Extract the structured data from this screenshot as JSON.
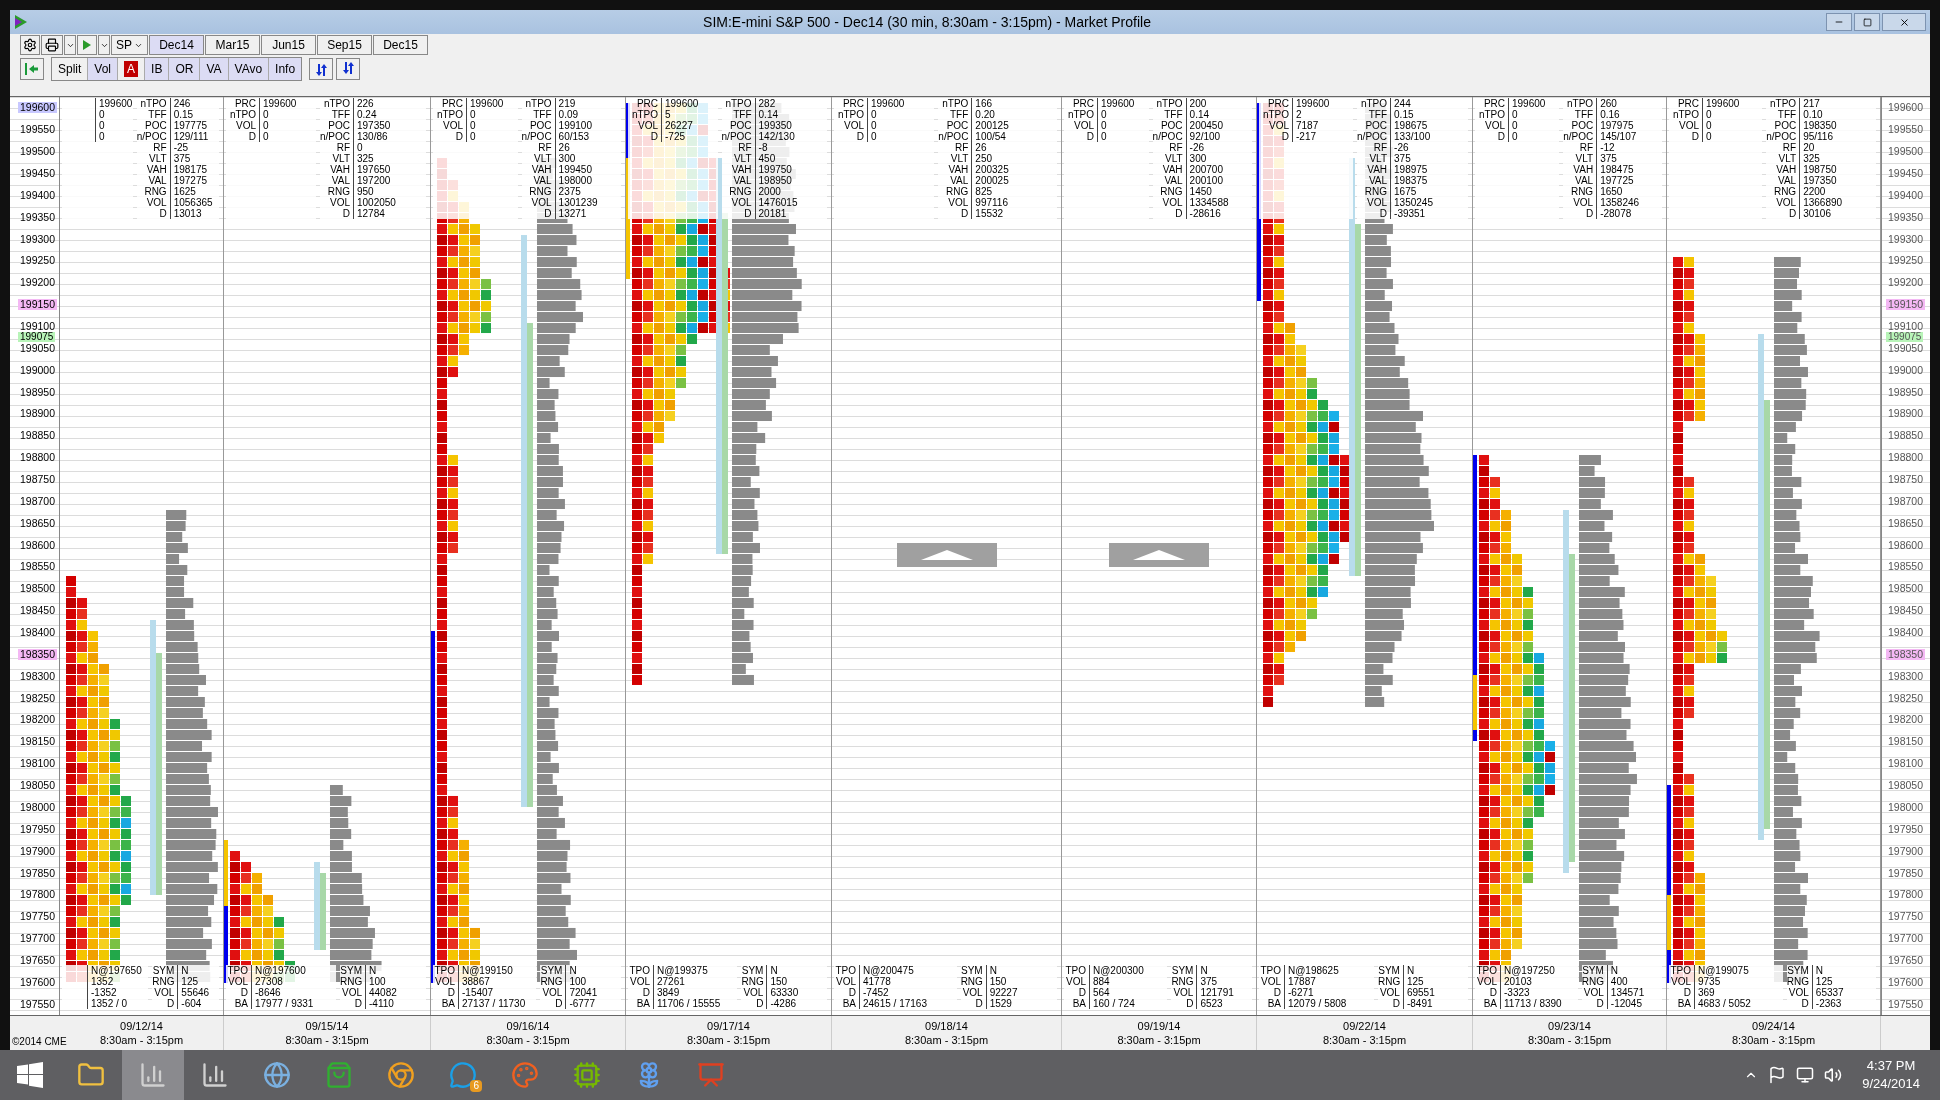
{
  "window": {
    "title": "SIM:E-mini S&P 500 - Dec14 (30 min, 8:30am - 3:15pm) - Market Profile"
  },
  "toolbar": {
    "symbol": "SP",
    "contracts": [
      {
        "label": "Dec14",
        "selected": true
      },
      {
        "label": "Mar15",
        "selected": false
      },
      {
        "label": "Jun15",
        "selected": false
      },
      {
        "label": "Sep15",
        "selected": false
      },
      {
        "label": "Dec15",
        "selected": false
      }
    ],
    "toggles": [
      {
        "label": "Split",
        "on": false,
        "kind": "text"
      },
      {
        "label": "Vol",
        "on": true,
        "kind": "text"
      },
      {
        "label": "A",
        "on": true,
        "kind": "letter"
      },
      {
        "label": "IB",
        "on": true,
        "kind": "text"
      },
      {
        "label": "OR",
        "on": true,
        "kind": "text"
      },
      {
        "label": "VA",
        "on": true,
        "kind": "text"
      },
      {
        "label": "VAvo",
        "on": true,
        "kind": "text"
      },
      {
        "label": "Info",
        "on": true,
        "kind": "text"
      }
    ]
  },
  "left_axis": [
    {
      "label": "199600",
      "color": "#c8c8ff"
    },
    {
      "label": "199550"
    },
    {
      "label": "199500"
    },
    {
      "label": "199450"
    },
    {
      "label": "199400"
    },
    {
      "label": "199350"
    },
    {
      "label": "199300"
    },
    {
      "label": "199250"
    },
    {
      "label": "199200"
    },
    {
      "label": "199150",
      "color": "#f4b8f4"
    },
    {
      "label": "199100"
    },
    {
      "label": "199075",
      "color": "#b8f4b8",
      "kind": "marker"
    },
    {
      "label": "199050"
    },
    {
      "label": "199000"
    },
    {
      "label": "198950"
    },
    {
      "label": "198900"
    },
    {
      "label": "198850"
    },
    {
      "label": "198800"
    },
    {
      "label": "198750"
    },
    {
      "label": "198700"
    },
    {
      "label": "198650"
    },
    {
      "label": "198600"
    },
    {
      "label": "198550"
    },
    {
      "label": "198500"
    },
    {
      "label": "198450"
    },
    {
      "label": "198400"
    },
    {
      "label": "198350",
      "color": "#f4b8f4"
    },
    {
      "label": "198300"
    },
    {
      "label": "198250"
    },
    {
      "label": "198200"
    },
    {
      "label": "198150"
    },
    {
      "label": "198100"
    },
    {
      "label": "198050"
    },
    {
      "label": "198000"
    },
    {
      "label": "197950"
    },
    {
      "label": "197900"
    },
    {
      "label": "197850"
    },
    {
      "label": "197800"
    },
    {
      "label": "197750"
    },
    {
      "label": "197700"
    },
    {
      "label": "197650"
    },
    {
      "label": "197600"
    },
    {
      "label": "197550"
    }
  ],
  "right_axis": [
    {
      "label": "199600"
    },
    {
      "label": "199550"
    },
    {
      "label": "199500"
    },
    {
      "label": "199450"
    },
    {
      "label": "199400"
    },
    {
      "label": "199350"
    },
    {
      "label": "199300"
    },
    {
      "label": "199250"
    },
    {
      "label": "199200"
    },
    {
      "label": "199150",
      "color": "#f4b8f4"
    },
    {
      "label": "199100"
    },
    {
      "label": "199075",
      "color": "#b8f4b8",
      "kind": "marker"
    },
    {
      "label": "199050"
    },
    {
      "label": "199000"
    },
    {
      "label": "198950"
    },
    {
      "label": "198900"
    },
    {
      "label": "198850"
    },
    {
      "label": "198800"
    },
    {
      "label": "198750"
    },
    {
      "label": "198700"
    },
    {
      "label": "198650"
    },
    {
      "label": "198600"
    },
    {
      "label": "198550"
    },
    {
      "label": "198500"
    },
    {
      "label": "198450"
    },
    {
      "label": "198400"
    },
    {
      "label": "198350",
      "color": "#f4b8f4"
    },
    {
      "label": "198300"
    },
    {
      "label": "198250"
    },
    {
      "label": "198200"
    },
    {
      "label": "198150"
    },
    {
      "label": "198100"
    },
    {
      "label": "198050"
    },
    {
      "label": "198000"
    },
    {
      "label": "197950"
    },
    {
      "label": "197900"
    },
    {
      "label": "197850"
    },
    {
      "label": "197800"
    },
    {
      "label": "197750"
    },
    {
      "label": "197700"
    },
    {
      "label": "197650"
    },
    {
      "label": "197600"
    },
    {
      "label": "197550"
    }
  ],
  "days": [
    {
      "date": "09/12/14",
      "session": "8:30am - 3:15pm",
      "kind": "profile",
      "top_left": [
        {
          "value": "199600"
        },
        {
          "value": "0"
        },
        {
          "value": "0"
        },
        {
          "value": "0"
        }
      ],
      "top_right": [
        {
          "label": "nTPO",
          "value": "246"
        },
        {
          "label": "TFF",
          "value": "0.15"
        },
        {
          "label": "POC",
          "value": "197775"
        },
        {
          "label": "n/POC",
          "value": "129/111"
        },
        {
          "label": "RF",
          "value": "-25"
        },
        {
          "label": "VLT",
          "value": "375"
        },
        {
          "label": "VAH",
          "value": "198175"
        },
        {
          "label": "VAL",
          "value": "197275"
        },
        {
          "label": "RNG",
          "value": "1625"
        },
        {
          "label": "VOL",
          "value": "1056365"
        },
        {
          "label": "D",
          "value": "13013"
        }
      ],
      "bottom_left": [
        {
          "value": "N@197650"
        },
        {
          "value": "1352"
        },
        {
          "value": "-1352"
        },
        {
          "value": "1352 / 0"
        }
      ],
      "bottom_right": [
        {
          "label": "SYM",
          "value": "N"
        },
        {
          "label": "RNG",
          "value": "125"
        },
        {
          "label": "VOL",
          "value": "55646"
        },
        {
          "label": "D",
          "value": "-604"
        }
      ]
    },
    {
      "date": "09/15/14",
      "session": "8:30am - 3:15pm",
      "kind": "profile",
      "top_left": [
        {
          "label": "PRC",
          "value": "199600"
        },
        {
          "label": "nTPO",
          "value": "0"
        },
        {
          "label": "VOL",
          "value": "0"
        },
        {
          "label": "D",
          "value": "0"
        }
      ],
      "top_right": [
        {
          "label": "nTPO",
          "value": "226"
        },
        {
          "label": "TFF",
          "value": "0.24"
        },
        {
          "label": "POC",
          "value": "197350"
        },
        {
          "label": "n/POC",
          "value": "130/86"
        },
        {
          "label": "RF",
          "value": "0"
        },
        {
          "label": "VLT",
          "value": "325"
        },
        {
          "label": "VAH",
          "value": "197650"
        },
        {
          "label": "VAL",
          "value": "197200"
        },
        {
          "label": "RNG",
          "value": "950"
        },
        {
          "label": "VOL",
          "value": "1002050"
        },
        {
          "label": "D",
          "value": "12784"
        }
      ],
      "bottom_left": [
        {
          "label": "TPO",
          "value": "N@197600"
        },
        {
          "label": "VOL",
          "value": "27308"
        },
        {
          "label": "D",
          "value": "-8646"
        },
        {
          "label": "BA",
          "value": "17977 / 9331"
        }
      ],
      "bottom_right": [
        {
          "label": "SYM",
          "value": "N"
        },
        {
          "label": "RNG",
          "value": "100"
        },
        {
          "label": "VOL",
          "value": "44082"
        },
        {
          "label": "D",
          "value": "-4110"
        }
      ]
    },
    {
      "date": "09/16/14",
      "session": "8:30am - 3:15pm",
      "kind": "profile",
      "top_left": [
        {
          "label": "PRC",
          "value": "199600"
        },
        {
          "label": "nTPO",
          "value": "0"
        },
        {
          "label": "VOL",
          "value": "0"
        },
        {
          "label": "D",
          "value": "0"
        }
      ],
      "top_right": [
        {
          "label": "nTPO",
          "value": "219"
        },
        {
          "label": "TFF",
          "value": "0.09"
        },
        {
          "label": "POC",
          "value": "199100"
        },
        {
          "label": "n/POC",
          "value": "60/153"
        },
        {
          "label": "RF",
          "value": "26"
        },
        {
          "label": "VLT",
          "value": "300"
        },
        {
          "label": "VAH",
          "value": "199450"
        },
        {
          "label": "VAL",
          "value": "198000"
        },
        {
          "label": "RNG",
          "value": "2375"
        },
        {
          "label": "VOL",
          "value": "1301239"
        },
        {
          "label": "D",
          "value": "13271"
        }
      ],
      "bottom_left": [
        {
          "label": "TPO",
          "value": "N@199150"
        },
        {
          "label": "VOL",
          "value": "38867"
        },
        {
          "label": "D",
          "value": "-15407"
        },
        {
          "label": "BA",
          "value": "27137 / 11730"
        }
      ],
      "bottom_right": [
        {
          "label": "SYM",
          "value": "N"
        },
        {
          "label": "RNG",
          "value": "100"
        },
        {
          "label": "VOL",
          "value": "72041"
        },
        {
          "label": "D",
          "value": "-6777"
        }
      ]
    },
    {
      "date": "09/17/14",
      "session": "8:30am - 3:15pm",
      "kind": "profile",
      "top_left": [
        {
          "label": "PRC",
          "value": "199600"
        },
        {
          "label": "nTPO",
          "value": "5"
        },
        {
          "label": "VOL",
          "value": "26227"
        },
        {
          "label": "D",
          "value": "-725"
        }
      ],
      "top_right": [
        {
          "label": "nTPO",
          "value": "282"
        },
        {
          "label": "TFF",
          "value": "0.14"
        },
        {
          "label": "POC",
          "value": "199350"
        },
        {
          "label": "n/POC",
          "value": "142/130"
        },
        {
          "label": "RF",
          "value": "-8"
        },
        {
          "label": "VLT",
          "value": "450"
        },
        {
          "label": "VAH",
          "value": "199750"
        },
        {
          "label": "VAL",
          "value": "198950"
        },
        {
          "label": "RNG",
          "value": "2000"
        },
        {
          "label": "VOL",
          "value": "1476015"
        },
        {
          "label": "D",
          "value": "20181"
        }
      ],
      "bottom_left": [
        {
          "label": "TPO",
          "value": "N@199375"
        },
        {
          "label": "VOL",
          "value": "27261"
        },
        {
          "label": "D",
          "value": "3849"
        },
        {
          "label": "BA",
          "value": "11706 / 15555"
        }
      ],
      "bottom_right": [
        {
          "label": "SYM",
          "value": "N"
        },
        {
          "label": "RNG",
          "value": "150"
        },
        {
          "label": "VOL",
          "value": "63330"
        },
        {
          "label": "D",
          "value": "-4286"
        }
      ]
    },
    {
      "date": "09/18/14",
      "session": "8:30am - 3:15pm",
      "kind": "empty",
      "top_left": [
        {
          "label": "PRC",
          "value": "199600"
        },
        {
          "label": "nTPO",
          "value": "0"
        },
        {
          "label": "VOL",
          "value": "0"
        },
        {
          "label": "D",
          "value": "0"
        }
      ],
      "top_right": [
        {
          "label": "nTPO",
          "value": "166"
        },
        {
          "label": "TFF",
          "value": "0.20"
        },
        {
          "label": "POC",
          "value": "200125"
        },
        {
          "label": "n/POC",
          "value": "100/54"
        },
        {
          "label": "RF",
          "value": "26"
        },
        {
          "label": "VLT",
          "value": "250"
        },
        {
          "label": "VAH",
          "value": "200325"
        },
        {
          "label": "VAL",
          "value": "200025"
        },
        {
          "label": "RNG",
          "value": "825"
        },
        {
          "label": "VOL",
          "value": "997116"
        },
        {
          "label": "D",
          "value": "15532"
        }
      ],
      "bottom_left": [
        {
          "label": "TPO",
          "value": "N@200475"
        },
        {
          "label": "VOL",
          "value": "41778"
        },
        {
          "label": "D",
          "value": "-7452"
        },
        {
          "label": "BA",
          "value": "24615 / 17163"
        }
      ],
      "bottom_right": [
        {
          "label": "SYM",
          "value": "N"
        },
        {
          "label": "RNG",
          "value": "150"
        },
        {
          "label": "VOL",
          "value": "92227"
        },
        {
          "label": "D",
          "value": "1529"
        }
      ]
    },
    {
      "date": "09/19/14",
      "session": "8:30am - 3:15pm",
      "kind": "empty",
      "top_left": [
        {
          "label": "PRC",
          "value": "199600"
        },
        {
          "label": "nTPO",
          "value": "0"
        },
        {
          "label": "VOL",
          "value": "0"
        },
        {
          "label": "D",
          "value": "0"
        }
      ],
      "top_right": [
        {
          "label": "nTPO",
          "value": "200"
        },
        {
          "label": "TFF",
          "value": "0.14"
        },
        {
          "label": "POC",
          "value": "200450"
        },
        {
          "label": "n/POC",
          "value": "92/100"
        },
        {
          "label": "RF",
          "value": "-26"
        },
        {
          "label": "VLT",
          "value": "300"
        },
        {
          "label": "VAH",
          "value": "200700"
        },
        {
          "label": "VAL",
          "value": "200100"
        },
        {
          "label": "RNG",
          "value": "1450"
        },
        {
          "label": "VOL",
          "value": "1334588"
        },
        {
          "label": "D",
          "value": "-28616"
        }
      ],
      "bottom_left": [
        {
          "label": "TPO",
          "value": "N@200300"
        },
        {
          "label": "VOL",
          "value": "884"
        },
        {
          "label": "D",
          "value": "564"
        },
        {
          "label": "BA",
          "value": "160 / 724"
        }
      ],
      "bottom_right": [
        {
          "label": "SYM",
          "value": "N"
        },
        {
          "label": "RNG",
          "value": "375"
        },
        {
          "label": "VOL",
          "value": "121791"
        },
        {
          "label": "D",
          "value": "6523"
        }
      ]
    },
    {
      "date": "09/22/14",
      "session": "8:30am - 3:15pm",
      "kind": "profile",
      "top_left": [
        {
          "label": "PRC",
          "value": "199600"
        },
        {
          "label": "nTPO",
          "value": "2"
        },
        {
          "label": "VOL",
          "value": "7187"
        },
        {
          "label": "D",
          "value": "-217"
        }
      ],
      "top_right": [
        {
          "label": "nTPO",
          "value": "244"
        },
        {
          "label": "TFF",
          "value": "0.15"
        },
        {
          "label": "POC",
          "value": "198675"
        },
        {
          "label": "n/POC",
          "value": "133/100"
        },
        {
          "label": "RF",
          "value": "-26"
        },
        {
          "label": "VLT",
          "value": "375"
        },
        {
          "label": "VAH",
          "value": "198975"
        },
        {
          "label": "VAL",
          "value": "198375"
        },
        {
          "label": "RNG",
          "value": "1675"
        },
        {
          "label": "VOL",
          "value": "1350245"
        },
        {
          "label": "D",
          "value": "-39351"
        }
      ],
      "bottom_left": [
        {
          "label": "TPO",
          "value": "N@198625"
        },
        {
          "label": "VOL",
          "value": "17887"
        },
        {
          "label": "D",
          "value": "-6271"
        },
        {
          "label": "BA",
          "value": "12079 / 5808"
        }
      ],
      "bottom_right": [
        {
          "label": "SYM",
          "value": "N"
        },
        {
          "label": "RNG",
          "value": "125"
        },
        {
          "label": "VOL",
          "value": "69551"
        },
        {
          "label": "D",
          "value": "-8491"
        }
      ]
    },
    {
      "date": "09/23/14",
      "session": "8:30am - 3:15pm",
      "kind": "profile",
      "top_left": [
        {
          "label": "PRC",
          "value": "199600"
        },
        {
          "label": "nTPO",
          "value": "0"
        },
        {
          "label": "VOL",
          "value": "0"
        },
        {
          "label": "D",
          "value": "0"
        }
      ],
      "top_right": [
        {
          "label": "nTPO",
          "value": "260"
        },
        {
          "label": "TFF",
          "value": "0.16"
        },
        {
          "label": "POC",
          "value": "197975"
        },
        {
          "label": "n/POC",
          "value": "145/107"
        },
        {
          "label": "RF",
          "value": "-12"
        },
        {
          "label": "VLT",
          "value": "375"
        },
        {
          "label": "VAH",
          "value": "198475"
        },
        {
          "label": "VAL",
          "value": "197725"
        },
        {
          "label": "RNG",
          "value": "1650"
        },
        {
          "label": "VOL",
          "value": "1358246"
        },
        {
          "label": "D",
          "value": "-28078"
        }
      ],
      "bottom_left": [
        {
          "label": "TPO",
          "value": "N@197250"
        },
        {
          "label": "VOL",
          "value": "20103"
        },
        {
          "label": "D",
          "value": "-3323"
        },
        {
          "label": "BA",
          "value": "11713 / 8390"
        }
      ],
      "bottom_right": [
        {
          "label": "SYM",
          "value": "N"
        },
        {
          "label": "RNG",
          "value": "400"
        },
        {
          "label": "VOL",
          "value": "134571"
        },
        {
          "label": "D",
          "value": "-12045"
        }
      ]
    },
    {
      "date": "09/24/14",
      "session": "8:30am - 3:15pm",
      "kind": "profile",
      "top_left": [
        {
          "label": "PRC",
          "value": "199600"
        },
        {
          "label": "nTPO",
          "value": "0"
        },
        {
          "label": "VOL",
          "value": "0"
        },
        {
          "label": "D",
          "value": "0"
        }
      ],
      "top_right": [
        {
          "label": "nTPO",
          "value": "217"
        },
        {
          "label": "TFF",
          "value": "0.10"
        },
        {
          "label": "POC",
          "value": "198350"
        },
        {
          "label": "n/POC",
          "value": "95/116"
        },
        {
          "label": "RF",
          "value": "20"
        },
        {
          "label": "VLT",
          "value": "325"
        },
        {
          "label": "VAH",
          "value": "198750"
        },
        {
          "label": "VAL",
          "value": "197350"
        },
        {
          "label": "RNG",
          "value": "2200"
        },
        {
          "label": "VOL",
          "value": "1366890"
        },
        {
          "label": "D",
          "value": "30106"
        }
      ],
      "bottom_left": [
        {
          "label": "TPO",
          "value": "N@199075"
        },
        {
          "label": "VOL",
          "value": "9735"
        },
        {
          "label": "D",
          "value": "369"
        },
        {
          "label": "BA",
          "value": "4683 / 5052"
        }
      ],
      "bottom_right": [
        {
          "label": "SYM",
          "value": "N"
        },
        {
          "label": "RNG",
          "value": "125"
        },
        {
          "label": "VOL",
          "value": "65337"
        },
        {
          "label": "D",
          "value": "-2363"
        }
      ]
    }
  ],
  "copyright": "©2014 CME",
  "taskbar": {
    "apps": [
      {
        "kind": "folder",
        "selected": false
      },
      {
        "kind": "chart",
        "selected": true
      },
      {
        "kind": "chart",
        "selected": false
      },
      {
        "kind": "globe",
        "selected": false
      },
      {
        "kind": "store",
        "selected": false
      },
      {
        "kind": "browser",
        "selected": false
      },
      {
        "kind": "chat",
        "selected": false,
        "badge": "6"
      },
      {
        "kind": "paint",
        "selected": false
      },
      {
        "kind": "gpu",
        "selected": false
      },
      {
        "kind": "flower",
        "selected": false
      },
      {
        "kind": "slides",
        "selected": false
      }
    ],
    "time": "4:37 PM",
    "date": "9/24/2014"
  }
}
